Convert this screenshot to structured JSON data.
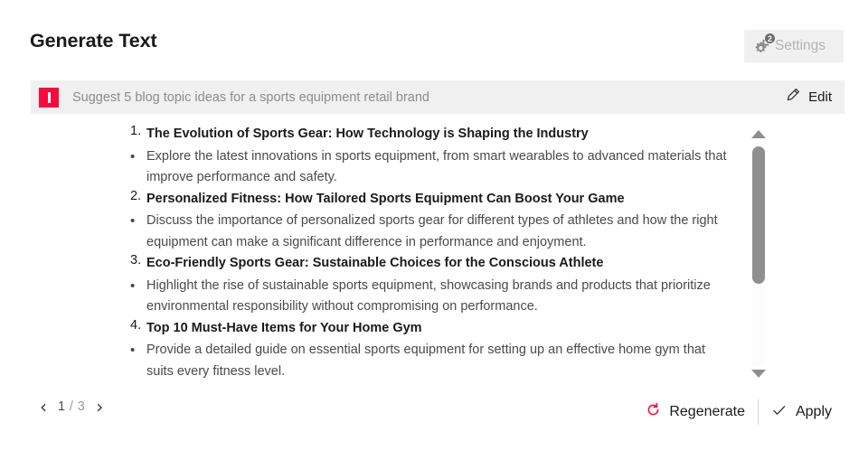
{
  "header": {
    "title": "Generate Text",
    "settings": {
      "label": "Settings",
      "badge": "2",
      "icon": "gear-icon"
    }
  },
  "prompt": {
    "icon": "prompt-mark-icon",
    "text": "Suggest 5 blog topic ideas for a sports equipment retail brand",
    "edit_label": "Edit",
    "edit_icon": "pencil-icon"
  },
  "result": {
    "items": [
      {
        "marker": "1.",
        "type": "heading",
        "text": "The Evolution of Sports Gear: How Technology is Shaping the Industry"
      },
      {
        "marker": "•",
        "type": "bullet",
        "text": "Explore the latest innovations in sports equipment, from smart wearables to advanced materials that improve performance and safety."
      },
      {
        "marker": "2.",
        "type": "heading",
        "text": "Personalized Fitness: How Tailored Sports Equipment Can Boost Your Game"
      },
      {
        "marker": "•",
        "type": "bullet",
        "text": "Discuss the importance of personalized sports gear for different types of athletes and how the right equipment can make a significant difference in performance and enjoyment."
      },
      {
        "marker": "3.",
        "type": "heading",
        "text": "Eco-Friendly Sports Gear: Sustainable Choices for the Conscious Athlete"
      },
      {
        "marker": "•",
        "type": "bullet",
        "text": "Highlight the rise of sustainable sports equipment, showcasing brands and products that prioritize environmental responsibility without compromising on performance."
      },
      {
        "marker": "4.",
        "type": "heading",
        "text": "Top 10 Must-Have Items for Your Home Gym"
      },
      {
        "marker": "•",
        "type": "bullet",
        "text": "Provide a detailed guide on essential sports equipment for setting up an effective home gym that suits every fitness level."
      }
    ],
    "scrollbar": {
      "up_icon": "scroll-up-arrow-icon",
      "down_icon": "scroll-down-arrow-icon"
    }
  },
  "footer": {
    "pager": {
      "prev_icon": "chevron-left-icon",
      "next_icon": "chevron-right-icon",
      "current": "1",
      "separator": " / ",
      "total": "3"
    },
    "regenerate": {
      "label": "Regenerate",
      "icon": "refresh-icon"
    },
    "apply": {
      "label": "Apply",
      "icon": "check-icon"
    }
  },
  "colors": {
    "accent_red": "#fa0a3c",
    "panel_gray": "#f0f0f0",
    "text_dark": "#1a1a1a",
    "text_muted": "#8c8c8c",
    "scrollbar": "#8f8f8f"
  }
}
